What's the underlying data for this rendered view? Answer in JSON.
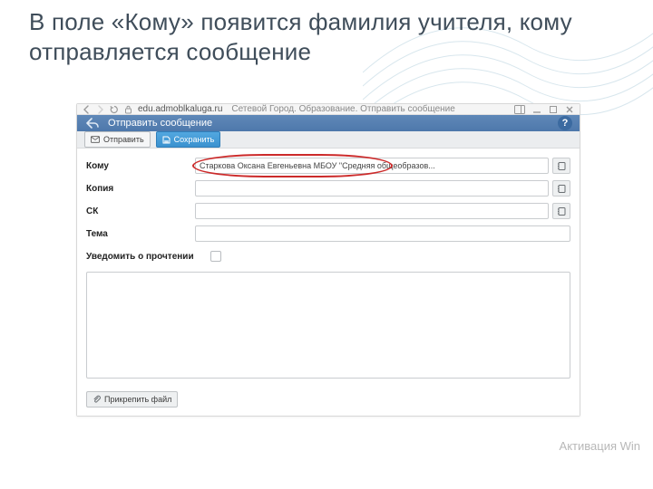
{
  "slide": {
    "title": "В поле «Кому» появится фамилия учителя, кому отправляется сообщение"
  },
  "chrome": {
    "domain": "edu.admoblkaluga.ru",
    "page_title": "Сетевой Город. Образование. Отправить сообщение"
  },
  "appbar": {
    "title": "Отправить сообщение",
    "help_label": "?"
  },
  "toolbar": {
    "send_label": "Отправить",
    "save_label": "Сохранить"
  },
  "form": {
    "to_label": "Кому",
    "to_value": "Старкова Оксана Евгеньевна МБОУ \"Средняя общеобразов...",
    "copy_label": "Копия",
    "copy_value": "",
    "sk_label": "СК",
    "sk_value": "",
    "subject_label": "Тема",
    "subject_value": "",
    "notify_label": "Уведомить о прочтении"
  },
  "attach": {
    "label": "Прикрепить файл"
  },
  "watermark": "Активация Win"
}
